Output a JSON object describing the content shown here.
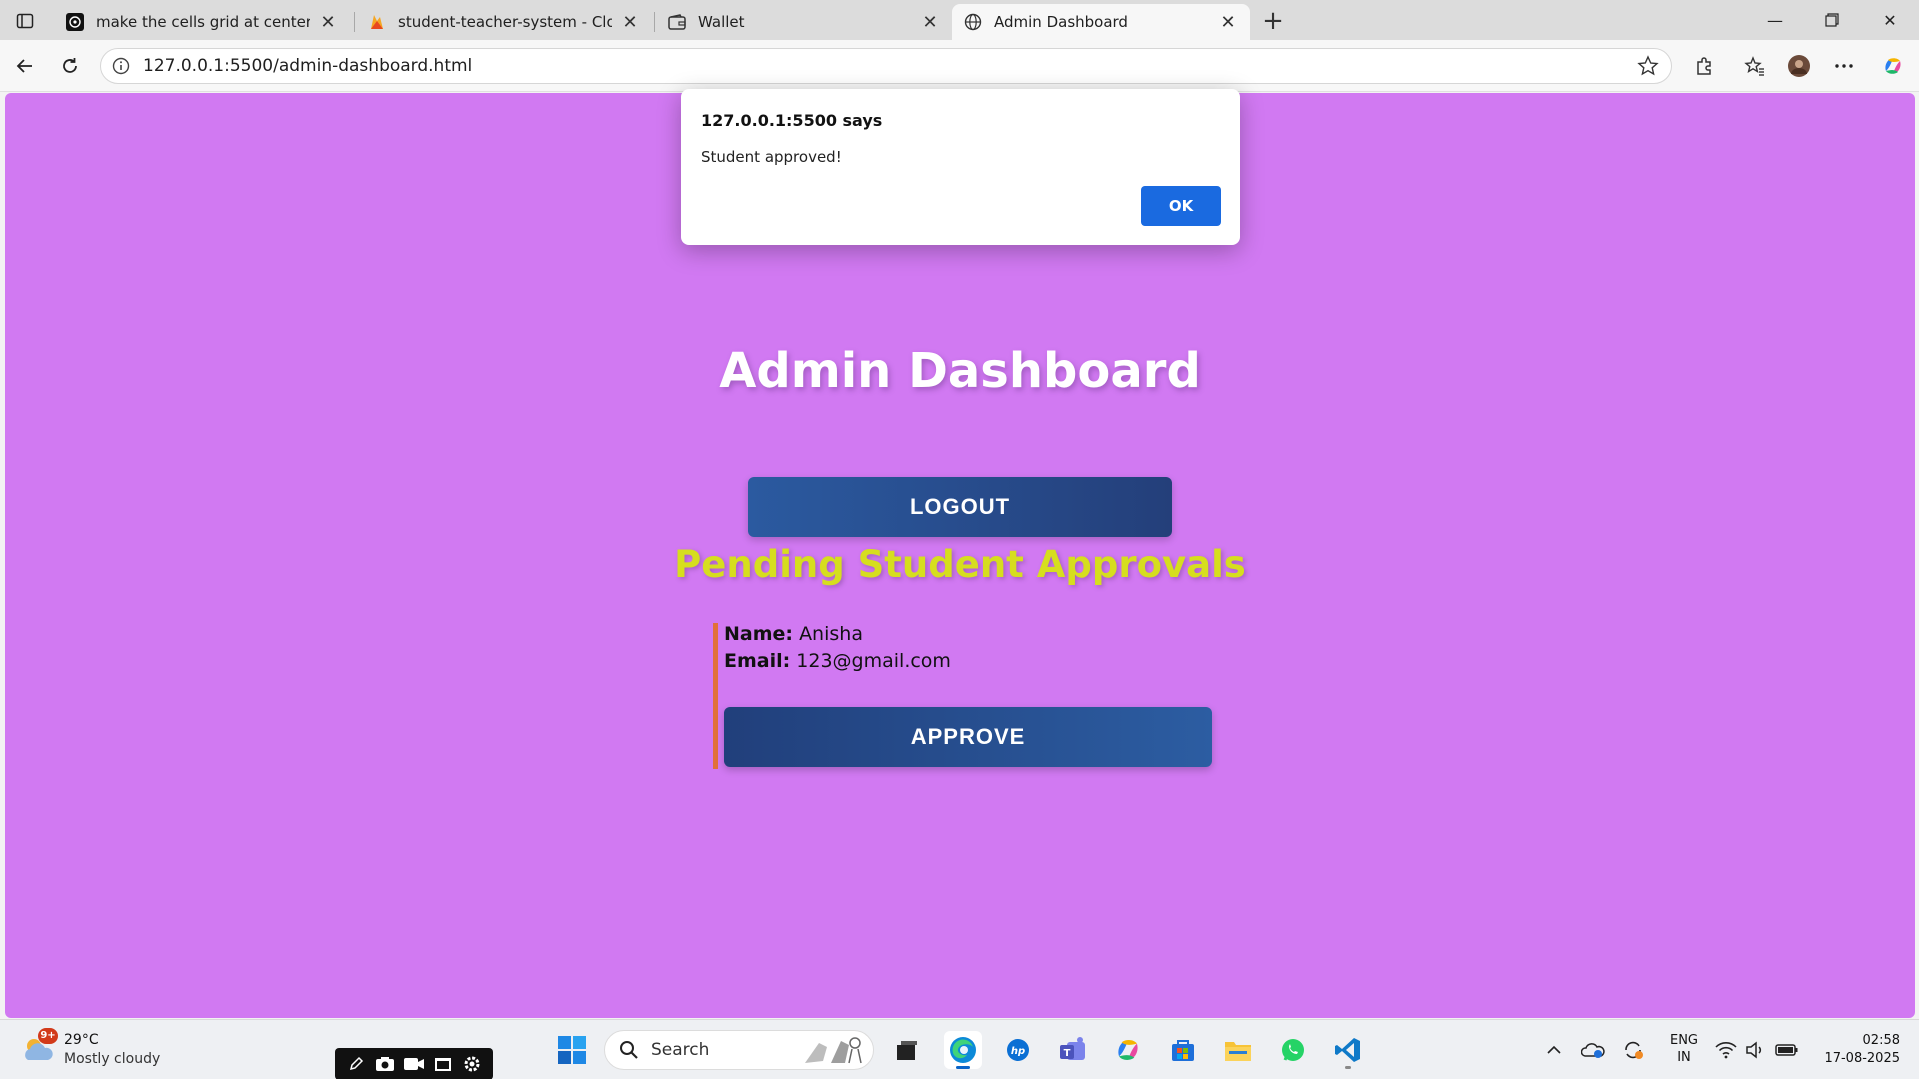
{
  "browser": {
    "tabs": [
      {
        "title": "make the cells grid at center and",
        "favicon": "chatgpt-icon"
      },
      {
        "title": "student-teacher-system - Cloud F",
        "favicon": "firebase-icon"
      },
      {
        "title": "Wallet",
        "favicon": "wallet-icon"
      },
      {
        "title": "Admin Dashboard",
        "favicon": "globe-icon",
        "active": true
      }
    ],
    "url": "127.0.0.1:5500/admin-dashboard.html"
  },
  "page": {
    "title": "Admin Dashboard",
    "logout_label": "LOGOUT",
    "section_title": "Pending Student Approvals",
    "students": [
      {
        "name_label": "Name:",
        "name": "Anisha",
        "email_label": "Email:",
        "email": "123@gmail.com",
        "approve_label": "APPROVE"
      }
    ],
    "colors": {
      "background": "#d179f2",
      "section_title": "#d6de1e",
      "card_border": "#e2703a",
      "button": "#2b5aa0"
    }
  },
  "dialog": {
    "title": "127.0.0.1:5500 says",
    "message": "Student approved!",
    "ok_label": "OK"
  },
  "taskbar": {
    "weather": {
      "badge": "9+",
      "temp": "29°C",
      "desc": "Mostly cloudy"
    },
    "search_placeholder": "Search",
    "lang": {
      "line1": "ENG",
      "line2": "IN"
    },
    "time": "02:58",
    "date": "17-08-2025"
  }
}
